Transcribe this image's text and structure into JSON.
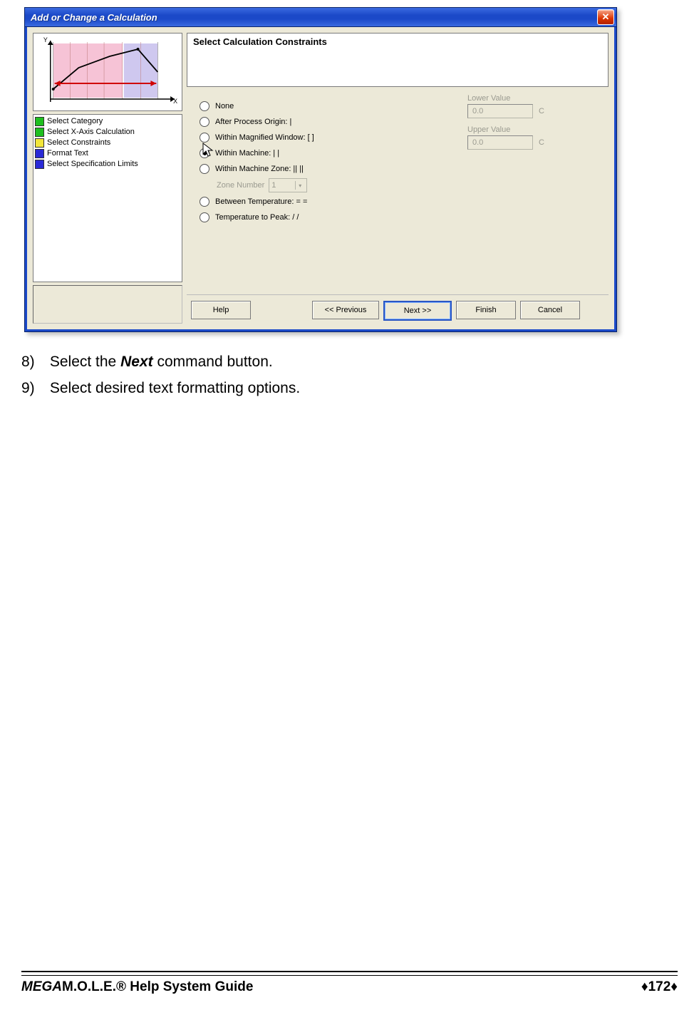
{
  "dialog": {
    "title": "Add or Change a Calculation",
    "close_glyph": "✕",
    "heading": "Select Calculation Constraints",
    "steps": [
      {
        "color": "#1fbf1f",
        "label": "Select Category"
      },
      {
        "color": "#1fbf1f",
        "label": "Select X-Axis Calculation"
      },
      {
        "color": "#f2e63a",
        "label": "Select Constraints"
      },
      {
        "color": "#2a2ad6",
        "label": "Format Text"
      },
      {
        "color": "#2a2ad6",
        "label": "Select Specification Limits"
      }
    ],
    "options": [
      {
        "label": "None",
        "selected": false
      },
      {
        "label": "After Process Origin: |",
        "selected": false
      },
      {
        "label": "Within Magnified Window: [  ]",
        "selected": false
      },
      {
        "label": "Within Machine: |  |",
        "selected": true
      },
      {
        "label": "Within Machine Zone: ||  ||",
        "selected": false
      }
    ],
    "zone": {
      "label": "Zone Number",
      "value": "1"
    },
    "extra_options": [
      {
        "label": "Between Temperature: =  =",
        "selected": false
      },
      {
        "label": "Temperature to Peak: /  /",
        "selected": false
      }
    ],
    "lower": {
      "label": "Lower Value",
      "value": "0.0",
      "unit": "C"
    },
    "upper": {
      "label": "Upper Value",
      "value": "0.0",
      "unit": "C"
    },
    "buttons": {
      "help": "Help",
      "prev": "<< Previous",
      "next": "Next >>",
      "finish": "Finish",
      "cancel": "Cancel"
    }
  },
  "body": {
    "step8_num": "8)",
    "step8_a": "Select the ",
    "step8_bold": "Next",
    "step8_b": " command button.",
    "step9_num": "9)",
    "step9": "Select desired text formatting options."
  },
  "footer": {
    "title_em": "MEGA",
    "title_rest": "M.O.L.E.® Help System Guide",
    "page": "172"
  }
}
